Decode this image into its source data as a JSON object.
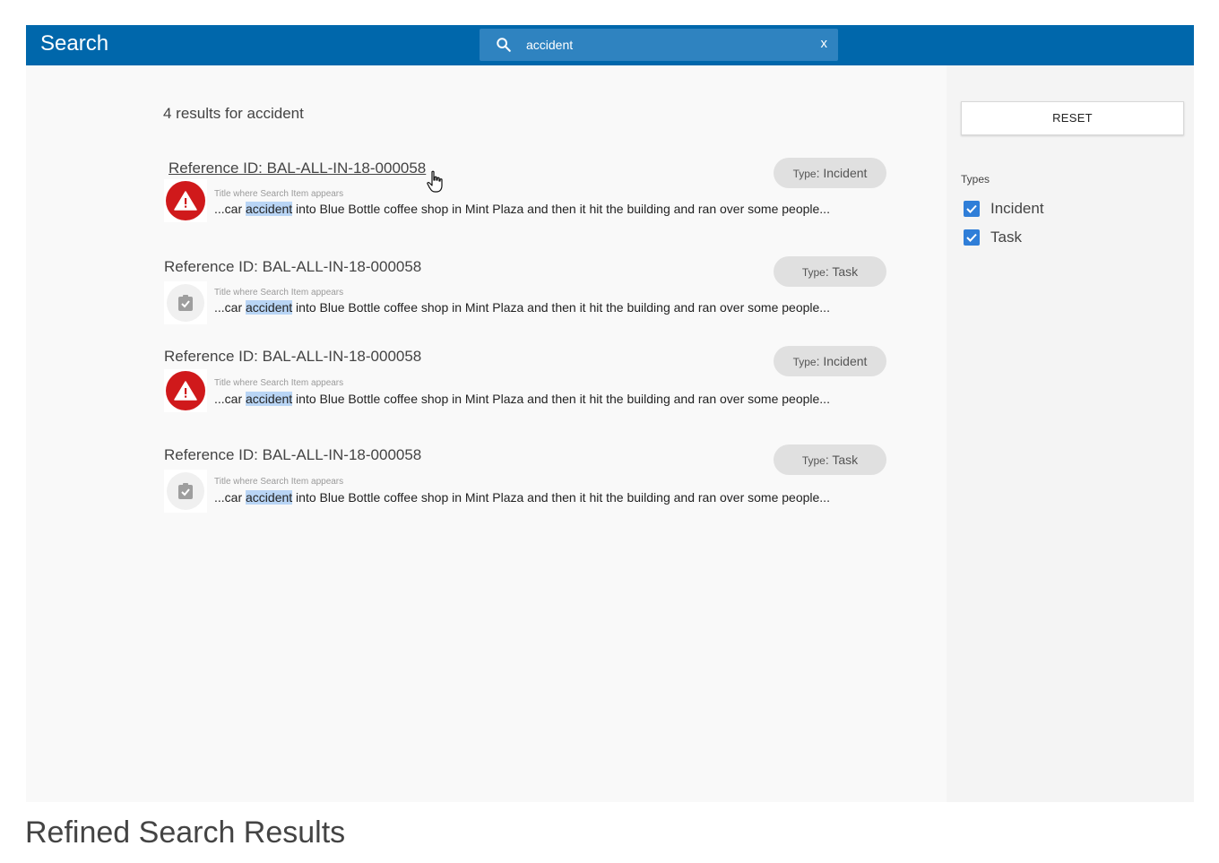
{
  "header": {
    "title": "Search",
    "search_value": "accident",
    "clear_label": "x"
  },
  "results": {
    "count_text": "4 results for accident",
    "items": [
      {
        "ref_id": "Reference ID: BAL-ALL-IN-18-000058",
        "type_key": "Type",
        "type_value": ": Incident",
        "subtitle": "Title where Search Item appears",
        "snippet_before": "...car ",
        "snippet_match": "accident",
        "snippet_after": " into Blue Bottle coffee shop in Mint Plaza and then it hit the building and ran over some people...",
        "icon": "warning-icon"
      },
      {
        "ref_id": "Reference ID: BAL-ALL-IN-18-000058",
        "type_key": "Type",
        "type_value": ": Task",
        "subtitle": "Title where Search Item appears",
        "snippet_before": "...car ",
        "snippet_match": "accident",
        "snippet_after": " into Blue Bottle coffee shop in Mint Plaza and then it hit the building and ran over some people...",
        "icon": "clipboard-check-icon"
      },
      {
        "ref_id": "Reference ID: BAL-ALL-IN-18-000058",
        "type_key": "Type",
        "type_value": ": Incident",
        "subtitle": "Title where Search Item appears",
        "snippet_before": "...car ",
        "snippet_match": "accident",
        "snippet_after": " into Blue Bottle coffee shop in Mint Plaza and then it hit the building and ran over some people...",
        "icon": "warning-icon"
      },
      {
        "ref_id": "Reference ID: BAL-ALL-IN-18-000058",
        "type_key": "Type",
        "type_value": ": Task",
        "subtitle": "Title where Search Item appears",
        "snippet_before": "...car ",
        "snippet_match": "accident",
        "snippet_after": " into Blue Bottle coffee shop in Mint Plaza and then it hit the building and ran over some people...",
        "icon": "clipboard-check-icon"
      }
    ]
  },
  "sidebar": {
    "reset_label": "RESET",
    "types_heading": "Types",
    "filters": [
      {
        "label": "Incident",
        "checked": true
      },
      {
        "label": "Task",
        "checked": true
      }
    ]
  },
  "footer": {
    "caption": "Refined Search Results"
  },
  "colors": {
    "header_bg": "#0067ab",
    "incident_red": "#d0191b",
    "checkbox_blue": "#2f7ed8",
    "highlight": "#b9d5f5"
  }
}
